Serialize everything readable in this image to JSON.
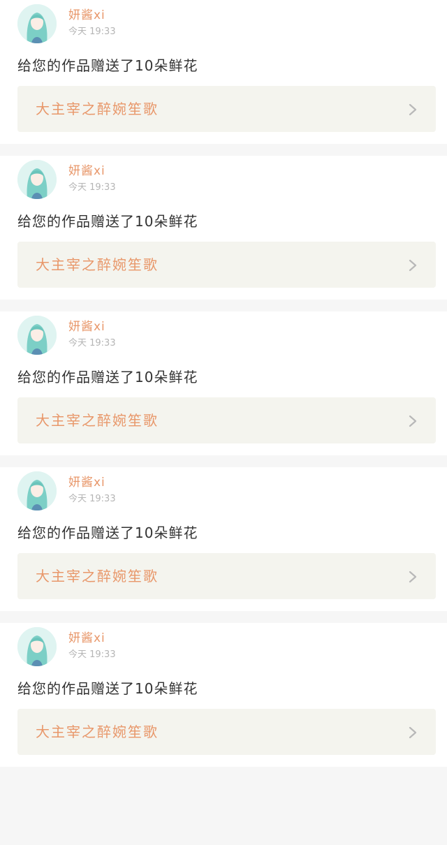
{
  "notifications": [
    {
      "user_name": "妍酱xi",
      "time": "今天 19:33",
      "message": "给您的作品赠送了10朵鲜花",
      "work_title": "大主宰之醉婉笙歌",
      "icon": "chevron-right-icon"
    },
    {
      "user_name": "妍酱xi",
      "time": "今天 19:33",
      "message": "给您的作品赠送了10朵鲜花",
      "work_title": "大主宰之醉婉笙歌",
      "icon": "chevron-right-icon"
    },
    {
      "user_name": "妍酱xi",
      "time": "今天 19:33",
      "message": "给您的作品赠送了10朵鲜花",
      "work_title": "大主宰之醉婉笙歌",
      "icon": "chevron-right-icon"
    },
    {
      "user_name": "妍酱xi",
      "time": "今天 19:33",
      "message": "给您的作品赠送了10朵鲜花",
      "work_title": "大主宰之醉婉笙歌",
      "icon": "chevron-right-icon"
    },
    {
      "user_name": "妍酱xi",
      "time": "今天 19:33",
      "message": "给您的作品赠送了10朵鲜花",
      "work_title": "大主宰之醉婉笙歌",
      "icon": "chevron-right-icon"
    }
  ],
  "colors": {
    "accent": "#e8976a",
    "time_gray": "#b5b5b5",
    "link_bg": "#f4f4ee",
    "separator": "#f6f6f6"
  }
}
